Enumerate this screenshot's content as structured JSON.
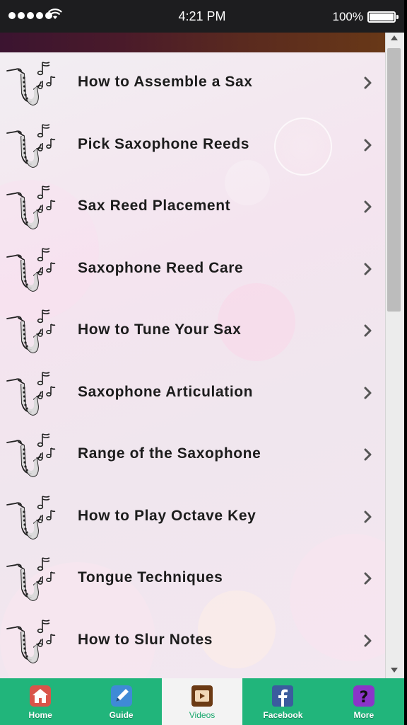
{
  "status_bar": {
    "time": "4:21 PM",
    "battery": "100%"
  },
  "list": {
    "items": [
      {
        "label": "How to Assemble a Sax"
      },
      {
        "label": "Pick Saxophone Reeds"
      },
      {
        "label": "Sax Reed Placement"
      },
      {
        "label": "Saxophone Reed Care"
      },
      {
        "label": "How to Tune Your Sax"
      },
      {
        "label": "Saxophone Articulation"
      },
      {
        "label": "Range of the Saxophone"
      },
      {
        "label": "How to Play Octave Key"
      },
      {
        "label": "Tongue Techniques"
      },
      {
        "label": "How to Slur Notes"
      }
    ],
    "item_icon": "saxophone-icon"
  },
  "tabs": [
    {
      "label": "Home",
      "icon": "home-icon",
      "color": "#d9544a"
    },
    {
      "label": "Guide",
      "icon": "guide-pen-icon",
      "color": "#3f8ad6"
    },
    {
      "label": "Videos",
      "icon": "video-icon",
      "color": "#6b3a14",
      "active": true
    },
    {
      "label": "Facebook",
      "icon": "facebook-icon",
      "color": "#3b5c9e"
    },
    {
      "label": "More",
      "icon": "more-question-icon",
      "color": "#8b35c8"
    }
  ],
  "colors": {
    "tab_bar": "#21b57b",
    "status_bar": "#1d1d1f"
  }
}
